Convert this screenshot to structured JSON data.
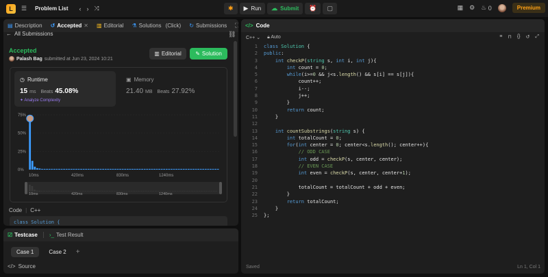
{
  "topbar": {
    "problem_list": "Problem List",
    "run_label": "Run",
    "submit_label": "Submit",
    "fire_count": "0",
    "premium_label": "Premium"
  },
  "left_tabs": [
    {
      "label": "Description"
    },
    {
      "label": "Accepted"
    },
    {
      "label": "Editorial"
    },
    {
      "label": "Solutions"
    },
    {
      "label": "(Click)"
    },
    {
      "label": "Submissions"
    }
  ],
  "submission": {
    "back_label": "All Submissions",
    "status": "Accepted",
    "author": "Palash Bag",
    "submitted_text": "submitted at Jun 23, 2024 10:21",
    "editorial_btn": "Editorial",
    "solution_btn": "Solution"
  },
  "runtime": {
    "title": "Runtime",
    "value": "15",
    "unit": "ms",
    "beats_label": "Beats",
    "beats_pct": "45.08%",
    "analyze": "Analyze Complexity"
  },
  "memory": {
    "title": "Memory",
    "value": "21.40",
    "unit": "MB",
    "beats_label": "Beats",
    "beats_pct": "27.92%"
  },
  "chart_data": {
    "type": "bar",
    "y_ticks": [
      "75%",
      "50%",
      "25%",
      "0%"
    ],
    "x_ticks": [
      "10ms",
      "420ms",
      "830ms",
      "1240ms"
    ],
    "mini_ticks": [
      "10ms",
      "420ms",
      "830ms",
      "1240ms"
    ],
    "ylim": [
      0,
      75
    ],
    "values": [
      72,
      12,
      4,
      2,
      1.5,
      1,
      1,
      1,
      1,
      1,
      1,
      1,
      1,
      1,
      1,
      1,
      1,
      1,
      1,
      1,
      1,
      1,
      1,
      1,
      1,
      1,
      1,
      1,
      1,
      1,
      1,
      1,
      1,
      1,
      1,
      1,
      1,
      1,
      1,
      1,
      1,
      1,
      1,
      1,
      1,
      1,
      1,
      1,
      1,
      1,
      1,
      1,
      1,
      1,
      1,
      1,
      1,
      1,
      1,
      1,
      1,
      1,
      1,
      1,
      1,
      1,
      1,
      1,
      1,
      1,
      1,
      1,
      1,
      1,
      1,
      1,
      1,
      1
    ],
    "highlight_index": 0,
    "bar_color": "#3c9cff"
  },
  "code_lang": {
    "label": "Code",
    "lang": "C++"
  },
  "code_snippet": "class Solution {",
  "editor": {
    "title": "Code",
    "lang": "C++",
    "auto": "Auto",
    "status": "Saved",
    "position": "Ln 1, Col 1"
  },
  "code_lines": [
    "class Solution {",
    "public:",
    "    int checkP(string s, int i, int j){",
    "        int count = 0;",
    "        while(i>=0 && j<s.length() && s[i] == s[j]){",
    "            count++;",
    "            i--;",
    "            j++;",
    "        }",
    "        return count;",
    "    }",
    "",
    "    int countSubstrings(string s) {",
    "        int totalCount = 0;",
    "        for(int center = 0; center<s.length(); center++){",
    "            // ODD CASE",
    "            int odd = checkP(s, center, center);",
    "            // EVEN CASE",
    "            int even = checkP(s, center, center+1);",
    "",
    "            totalCount = totalCount + odd + even;",
    "        }",
    "        return totalCount;",
    "    }",
    "};"
  ],
  "bottom": {
    "testcase": "Testcase",
    "test_result": "Test Result",
    "case1": "Case 1",
    "case2": "Case 2",
    "source": "Source"
  }
}
